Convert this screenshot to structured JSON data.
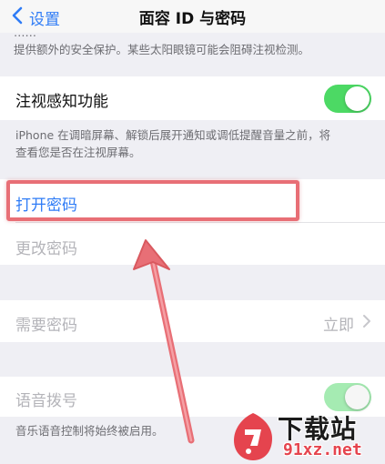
{
  "nav": {
    "back_label": "设置",
    "title": "面容 ID 与密码"
  },
  "top_footer": {
    "line1_cut": "……",
    "line2": "提供额外的安全保护。某些太阳眼镜可能会阻碍注视检测。"
  },
  "attention": {
    "label": "注视感知功能",
    "toggle_on": true,
    "footer_line1": "iPhone 在调暗屏幕、解锁后展开通知或调低提醒音量之前，将",
    "footer_line2": "查看您是否在注视屏幕。"
  },
  "passcode": {
    "turn_on": "打开密码",
    "change": "更改密码"
  },
  "require": {
    "label": "需要密码",
    "value": "立即"
  },
  "voice_dial": {
    "label": "语音拨号",
    "toggle_on": true,
    "footer": "音乐语音控制将始终被启用。"
  },
  "colors": {
    "link_blue": "#2f7cf6",
    "toggle_green": "#4cd964",
    "annotation_red": "#e86f76",
    "background": "#efeff4"
  },
  "watermark": {
    "name": "下载站",
    "url": "91xz.net"
  }
}
